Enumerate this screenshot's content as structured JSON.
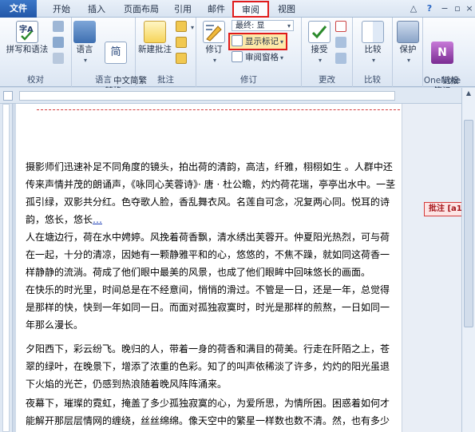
{
  "tabs": {
    "file": "文件",
    "home": "开始",
    "insert": "插入",
    "page_layout": "页面布局",
    "references": "引用",
    "mailings": "邮件",
    "review": "审阅",
    "view": "视图"
  },
  "ribbon": {
    "proofing": {
      "label": "校对",
      "spelling": "拼写和语法"
    },
    "language": {
      "label": "语言",
      "chinese_convert": "中文简繁\n转换"
    },
    "comments": {
      "label": "批注",
      "new_comment": "新建批注"
    },
    "tracking": {
      "label": "修订",
      "track_changes": "修订",
      "final": "最终: 显",
      "show_markup": "显示标记",
      "reviewing_pane": "审阅窗格"
    },
    "changes": {
      "label": "更改",
      "accept": "接受"
    },
    "compare": {
      "label": "比较",
      "compare": "比较"
    },
    "protect": {
      "label": "",
      "protect": "保护"
    },
    "onenote": {
      "label": "OneNote",
      "linked_notes": "链接\n笔记"
    }
  },
  "document": {
    "p1": "摄影师们迅速补足不同角度的镜头，拍出荷的清韵，高洁，纤雅，栩栩如生 。人群中还传来声情并茂的朗诵声，《咏同心芙蓉诗》· 唐 · 杜公瞻，灼灼荷花瑞，亭亭出水中。一茎孤引绿，双影共分红。色夺歌人脸，香乱舞衣风。名莲自可念，况复两心同。悦耳的诗韵，悠长，悠长",
    "p1_tail": "…",
    "p2": "人在塘边行，荷在水中娉婷。风挽着荷香飘，清水绣出芙蓉开。仲夏阳光热烈，可与荷在一起，十分的清凉，因她有一颗静雅平和的心，悠悠的，不焦不躁，就如同这荷香一样静静的流淌。荷成了他们眼中最美的风景，也成了他们眼眸中回味悠长的画面。",
    "p3": "在快乐的时光里，时间总是在不经意间，悄悄的滑过。不管是一日，还是一年，总觉得是那样的快，快到一年如同一日。而面对孤独寂寞时，时光是那样的煎熬，一日如同一年那么漫长。",
    "p4": "夕阳西下，彩云纷飞。晚归的人，带着一身的荷香和满目的荷美。行走在阡陌之上，苍翠的绿叶，在晚景下，增添了浓重的色彩。知了的叫声依稀淡了许多，灼灼的阳光虽退下火焰的光芒，仍感到热浪随着晚风阵阵涌来。",
    "p5": "夜幕下，璀璨的霓虹，掩盖了多少孤独寂寞的心，为爱所思，为情所困。困惑着如何才能解开那层层情网的缠绕，丝丝绵绵。像天空中的繁星一样数也数不清。然，也有多少甜蜜的热恋，沉浸在浪漫的爱恋中，不分彼此，亲如一人。"
  },
  "comment_balloon": "批注 [a1]:",
  "colors": {
    "accent_red": "#e01b1b",
    "insert_blue": "#1d3fb7",
    "ribbon_bg": "#e5edf7"
  }
}
